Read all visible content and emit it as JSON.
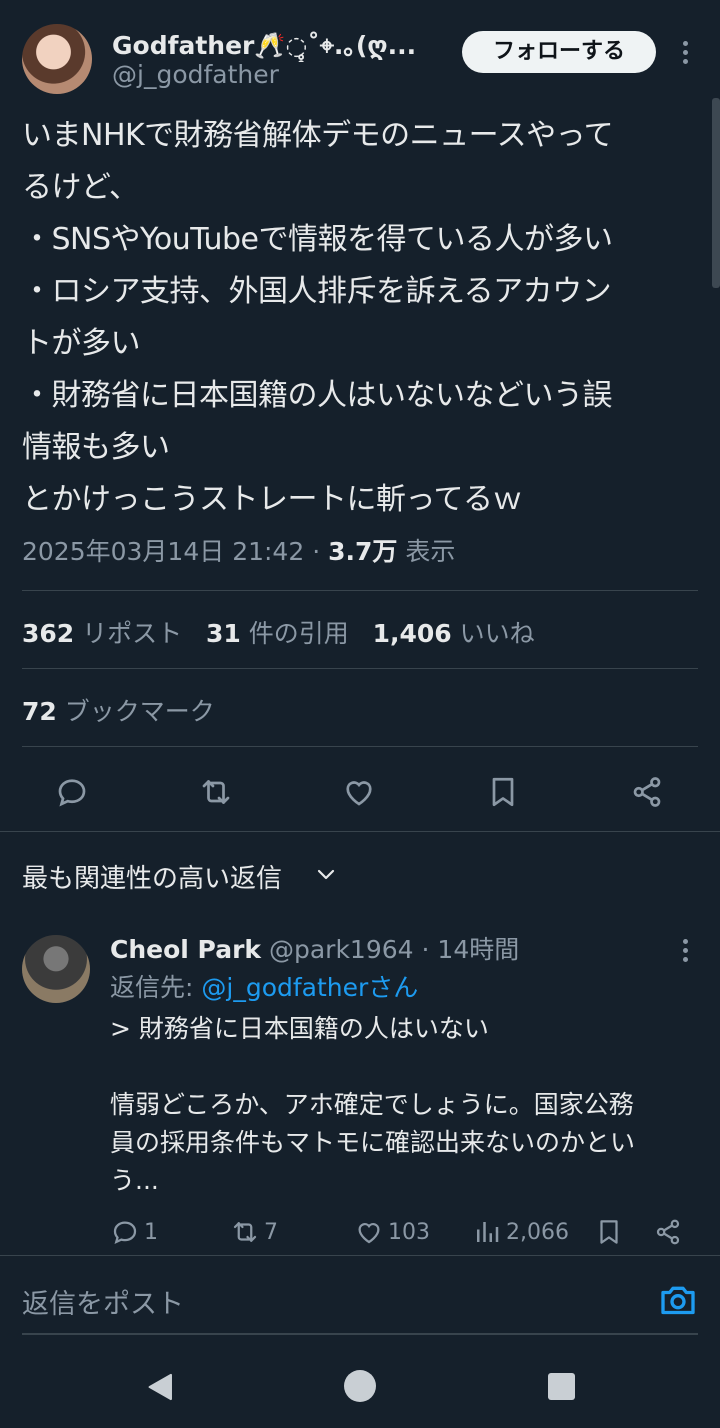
{
  "tweet": {
    "author": {
      "display_name": "Godfather🥂◌̥̥̥˚⌖.｡(ღ...",
      "handle": "@j_godfather"
    },
    "follow_label": "フォローする",
    "body_lines": [
      "いまNHKで財務省解体デモのニュースやって",
      "るけど、",
      "・SNSやYouTubeで情報を得ている人が多い",
      "・ロシア支持、外国人排斥を訴えるアカウン",
      "トが多い",
      "・財務省に日本国籍の人はいないなどいう誤",
      "情報も多い",
      "とかけっこうストレートに斬ってるｗ"
    ],
    "timestamp": "2025年03月14日 21:42",
    "separator": "·",
    "views_count": "3.7万",
    "views_label": "表示",
    "stats": {
      "reposts_count": "362",
      "reposts_label": "リポスト",
      "quotes_count": "31",
      "quotes_label": "件の引用",
      "likes_count": "1,406",
      "likes_label": "いいね",
      "bookmarks_count": "72",
      "bookmarks_label": "ブックマーク"
    }
  },
  "actions": [
    "reply-icon",
    "retweet-icon",
    "heart-icon",
    "bookmark-icon",
    "share-icon"
  ],
  "replies_section": {
    "sort_label": "最も関連性の高い返信"
  },
  "reply": {
    "name": "Cheol Park",
    "handle": "@park1964",
    "separator": "·",
    "time": "14時間",
    "reply_to_prefix": "返信先:",
    "reply_to_handle": "@j_godfatherさん",
    "body_lines": [
      "> 財務省に日本国籍の人はいない",
      "",
      "情弱どころか、アホ確定でしょうに。国家公務",
      "員の採用条件もマトモに確認出来ないのかとい",
      "う..."
    ],
    "replies": "1",
    "reposts": "7",
    "likes": "103",
    "views": "2,066"
  },
  "compose": {
    "placeholder": "返信をポスト"
  },
  "colors": {
    "background": "#15202b",
    "text": "#e7e9ea",
    "muted": "#8b98a5",
    "accent": "#1d9bf0"
  }
}
